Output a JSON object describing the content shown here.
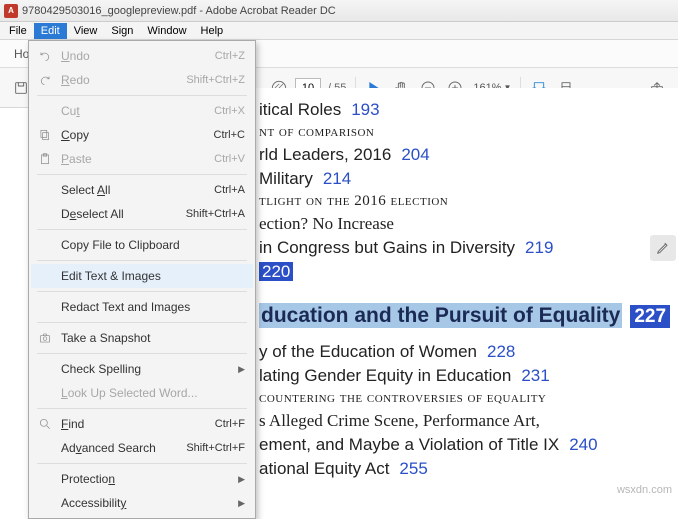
{
  "window": {
    "title": "9780429503016_googlepreview.pdf - Adobe Acrobat Reader DC"
  },
  "menubar": {
    "items": [
      "File",
      "Edit",
      "View",
      "Sign",
      "Window",
      "Help"
    ],
    "active_index": 1
  },
  "home": {
    "label": "Ho"
  },
  "toolbar": {
    "page_current": "10",
    "page_total": "/ 55",
    "zoom": "161%"
  },
  "edit_menu": {
    "undo": "Undo",
    "undo_sc": "Ctrl+Z",
    "redo": "Redo",
    "redo_sc": "Shift+Ctrl+Z",
    "cut": "Cut",
    "cut_sc": "Ctrl+X",
    "copy": "Copy",
    "copy_sc": "Ctrl+C",
    "paste": "Paste",
    "paste_sc": "Ctrl+V",
    "select_all": "Select All",
    "select_all_sc": "Ctrl+A",
    "deselect_all": "Deselect All",
    "deselect_all_sc": "Shift+Ctrl+A",
    "copy_file": "Copy File to Clipboard",
    "edit_ti": "Edit Text & Images",
    "redact": "Redact Text and Images",
    "snapshot": "Take a Snapshot",
    "spelling": "Check Spelling",
    "lookup": "Look Up Selected Word...",
    "find": "Find",
    "find_sc": "Ctrl+F",
    "adv_search": "Advanced Search",
    "adv_search_sc": "Shift+Ctrl+F",
    "protection": "Protection",
    "accessibility": "Accessibility"
  },
  "doc": {
    "l1_a": "itical Roles",
    "l1_p": "193",
    "l2_sc": "nt of comparison",
    "l3_a": "rld Leaders, 2016",
    "l3_p": "204",
    "l4_a": "Military",
    "l4_p": "214",
    "l5_sc": "tlight on the 2016 election",
    "l6_a": "ection? No Increase",
    "l7_a": "in Congress but Gains in Diversity",
    "l7_p": "219",
    "l8_p": "220",
    "sec_title": "ducation and the Pursuit of Equality",
    "sec_page": "227",
    "l9_a": "y of the Education of Women",
    "l9_p": "228",
    "l10_a": "lating Gender Equity in Education",
    "l10_p": "231",
    "l11_sc": "countering the controversies of equality",
    "l12_a": "s Alleged Crime Scene, Performance Art,",
    "l13_a": "ement, and Maybe a Violation of Title IX",
    "l13_p": "240",
    "l14_a": "ational Equity Act",
    "l14_p": "255"
  },
  "watermark": "wsxdn.com"
}
